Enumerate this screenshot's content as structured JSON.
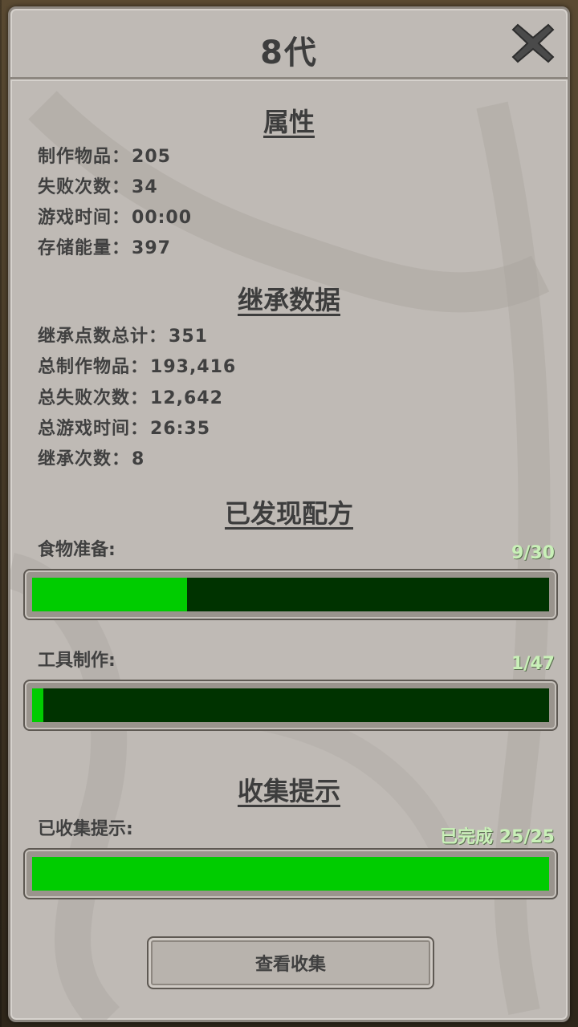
{
  "header": {
    "title": "8代"
  },
  "attributes": {
    "heading": "属性",
    "stats": [
      {
        "label": "制作物品：",
        "value": "205"
      },
      {
        "label": "失败次数：",
        "value": "34"
      },
      {
        "label": "游戏时间：",
        "value": "00:00"
      },
      {
        "label": "存储能量：",
        "value": "397"
      }
    ]
  },
  "inheritance": {
    "heading": "继承数据",
    "stats": [
      {
        "label": "继承点数总计：",
        "value": "351"
      },
      {
        "label": "总制作物品：",
        "value": "193,416"
      },
      {
        "label": "总失败次数：",
        "value": "12,642"
      },
      {
        "label": "总游戏时间：",
        "value": "26:35"
      },
      {
        "label": "继承次数：",
        "value": "8"
      }
    ]
  },
  "recipes": {
    "heading": "已发现配方",
    "bars": [
      {
        "label": "食物准备:",
        "count": "9/30",
        "fraction": 0.3
      },
      {
        "label": "工具制作:",
        "count": "1/47",
        "fraction": 0.0213
      }
    ]
  },
  "hints": {
    "heading": "收集提示",
    "bar": {
      "label": "已收集提示:",
      "count": "已完成  25/25",
      "fraction": 1.0
    }
  },
  "actions": {
    "view_collection": "查看收集"
  },
  "colors": {
    "bar_fill": "#00cc00",
    "bar_track": "#003300",
    "count_text": "#c9f0b8",
    "panel": "#bfbab5"
  },
  "icons": {
    "close": "close-icon"
  }
}
